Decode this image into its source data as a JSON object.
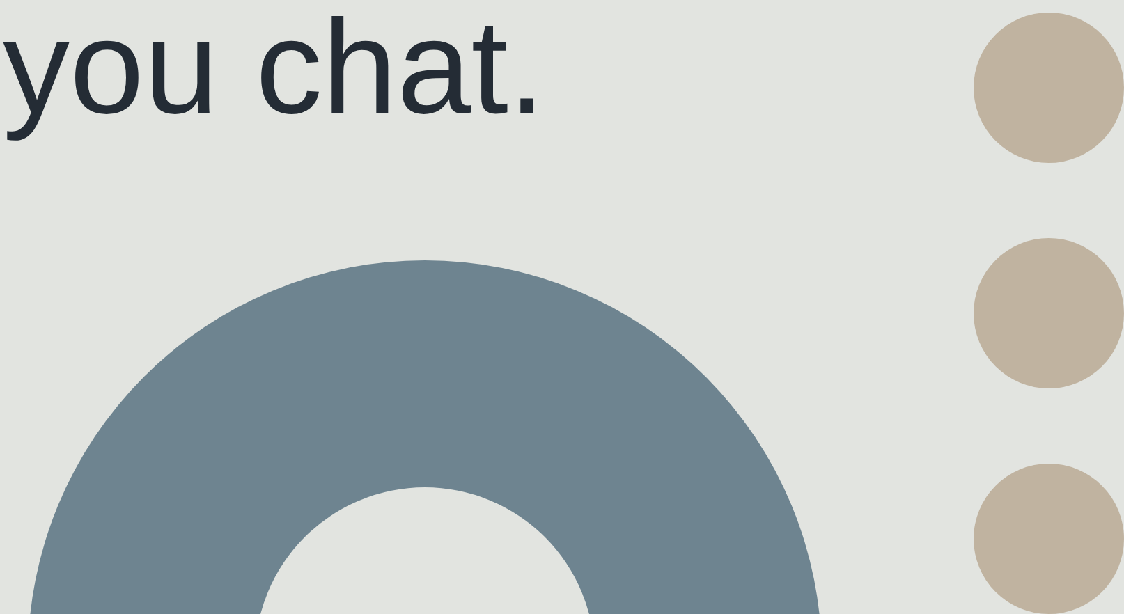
{
  "headline": "you chat."
}
